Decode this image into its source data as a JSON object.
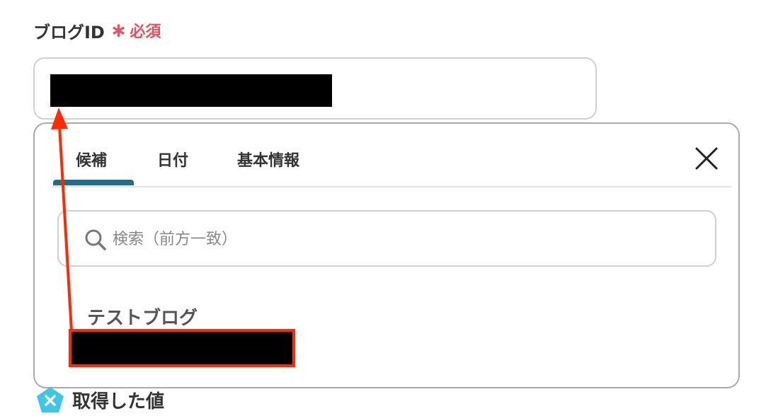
{
  "field": {
    "label": "ブログID",
    "required_mark": "∗",
    "required_text": "必須",
    "accent_color": "#e8505b"
  },
  "popup": {
    "tabs": [
      {
        "label": "候補",
        "active": true
      },
      {
        "label": "日付",
        "active": false
      },
      {
        "label": "基本情報",
        "active": false
      }
    ],
    "close_icon": "close-icon",
    "active_tab_color": "#1f6f8b",
    "search": {
      "icon": "search-icon",
      "placeholder": "検索（前方一致）",
      "value": ""
    },
    "candidates": [
      {
        "name": "テストブログ"
      }
    ]
  },
  "annotation": {
    "highlight_color": "#ff2a00"
  },
  "output": {
    "icon": "output-x-icon",
    "label": "取得した値",
    "icon_color": "#3ec6e8"
  }
}
